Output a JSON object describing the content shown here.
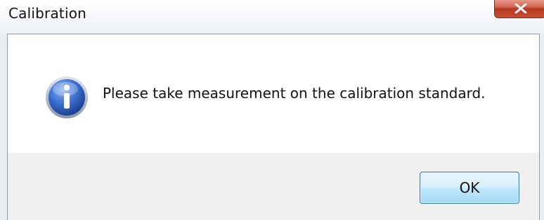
{
  "window": {
    "title": "Calibration",
    "close_icon": "close-icon"
  },
  "message": {
    "icon": "info-icon",
    "text": "Please take measurement on the calibration standard."
  },
  "buttons": {
    "ok_label": "OK"
  },
  "colors": {
    "close_button": "#c84e35",
    "ok_button_border": "#3c7fb1",
    "info_icon_blue": "#2f5fbf",
    "content_bg": "#ffffff",
    "footer_bg": "#f0f0f0"
  }
}
